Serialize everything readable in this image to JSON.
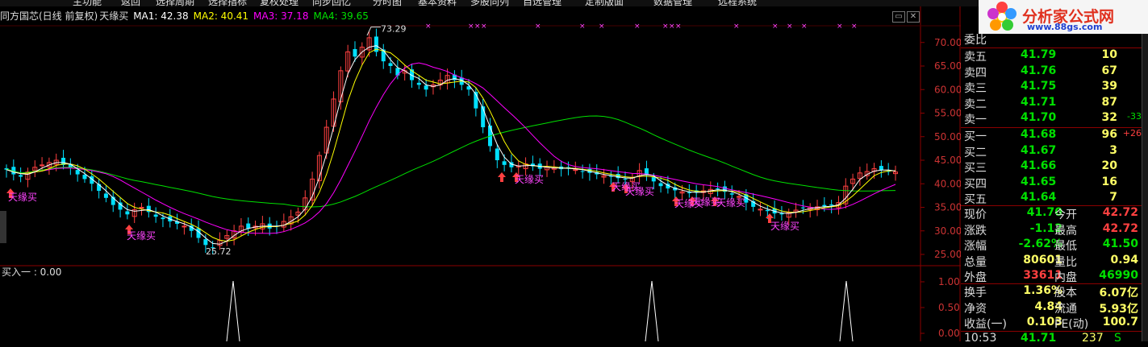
{
  "menubar": {
    "items": [
      "主功能",
      "返回",
      "选择周期",
      "选择指标",
      "复权处理",
      "同步回忆",
      "分时图",
      "基本资料",
      "多股同列",
      "自选管理",
      "定制版面",
      "数据管理",
      "远程系统"
    ]
  },
  "chart_header": {
    "stock": "同方国芯(日线 前复权)",
    "indicator": "天缘买",
    "ma1": "MA1: 42.38",
    "ma2": "MA2: 40.41",
    "ma3": "MA3: 37.18",
    "ma4": "MA4: 39.65"
  },
  "sub_header": {
    "label": "买入一 : 0.00"
  },
  "main_chart": {
    "y_ticks": [
      "70.00",
      "65.00",
      "60.00",
      "55.00",
      "50.00",
      "45.00",
      "40.00",
      "35.00",
      "30.00",
      "25.00"
    ],
    "high_label": "73.29",
    "low_label": "25.72",
    "signal_label": "天缘买"
  },
  "sub_chart": {
    "y_ticks": [
      "1.00",
      "0.50",
      "0.00"
    ]
  },
  "logo": {
    "title": "分析家公式网",
    "url": "www.88gs.com"
  },
  "quote_panel": {
    "weibi_label": "委比",
    "asks": [
      {
        "label": "卖五",
        "price": "41.79",
        "vol": "10",
        "chg": ""
      },
      {
        "label": "卖四",
        "price": "41.76",
        "vol": "67",
        "chg": ""
      },
      {
        "label": "卖三",
        "price": "41.75",
        "vol": "39",
        "chg": ""
      },
      {
        "label": "卖二",
        "price": "41.71",
        "vol": "87",
        "chg": ""
      },
      {
        "label": "卖一",
        "price": "41.70",
        "vol": "32",
        "chg": "-33"
      }
    ],
    "bids": [
      {
        "label": "买一",
        "price": "41.68",
        "vol": "96",
        "chg": "+26"
      },
      {
        "label": "买二",
        "price": "41.67",
        "vol": "3",
        "chg": ""
      },
      {
        "label": "买三",
        "price": "41.66",
        "vol": "20",
        "chg": ""
      },
      {
        "label": "买四",
        "price": "41.65",
        "vol": "16",
        "chg": ""
      },
      {
        "label": "买五",
        "price": "41.64",
        "vol": "7",
        "chg": ""
      }
    ],
    "stats": [
      {
        "l1": "现价",
        "v1": "41.70",
        "c1": "#00e000",
        "l2": "今开",
        "v2": "42.72",
        "c2": "#ff4040"
      },
      {
        "l1": "涨跌",
        "v1": "-1.12",
        "c1": "#00e000",
        "l2": "最高",
        "v2": "42.72",
        "c2": "#ff4040"
      },
      {
        "l1": "涨幅",
        "v1": "-2.62%",
        "c1": "#00e000",
        "l2": "最低",
        "v2": "41.50",
        "c2": "#00e000"
      },
      {
        "l1": "总量",
        "v1": "80601",
        "c1": "#ffff66",
        "l2": "量比",
        "v2": "0.94",
        "c2": "#ffff66"
      },
      {
        "l1": "外盘",
        "v1": "33611",
        "c1": "#ff4040",
        "l2": "内盘",
        "v2": "46990",
        "c2": "#00e000"
      }
    ],
    "stats2": [
      {
        "l1": "换手",
        "v1": "1.36%",
        "l2": "股本",
        "v2": "6.07亿"
      },
      {
        "l1": "净资",
        "v1": "4.84",
        "l2": "流通",
        "v2": "5.93亿"
      },
      {
        "l1": "收益(一)",
        "v1": "0.103",
        "l2": "PE(动)",
        "v2": "100.7"
      }
    ],
    "tick": {
      "time": "10:53",
      "price": "41.71",
      "vol": "237",
      "side": "S"
    }
  },
  "colors": {
    "up": "#ff4040",
    "down": "#00e0ff",
    "ma1": "#ffffff",
    "ma2": "#ffff00",
    "ma3": "#ff00ff",
    "ma4": "#00e000",
    "grid": "#8b0000",
    "signal": "#ff44ff"
  }
}
